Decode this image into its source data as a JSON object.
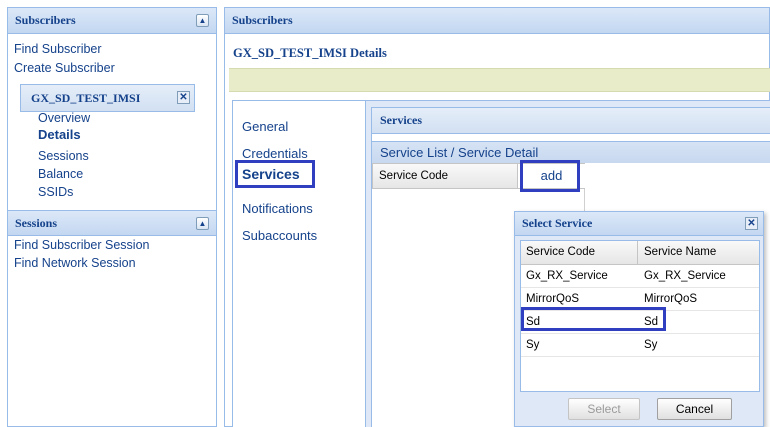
{
  "left_nav": {
    "subscribers_header": "Subscribers",
    "links": [
      "Find Subscriber",
      "Create Subscriber"
    ],
    "subscriber_tab": {
      "label": "GX_SD_TEST_IMSI",
      "items": [
        "Overview",
        "Details",
        "Sessions",
        "Balance",
        "SSIDs"
      ],
      "active": "Details"
    },
    "sessions_header": "Sessions",
    "session_links": [
      "Find Subscriber Session",
      "Find Network Session"
    ]
  },
  "main": {
    "header": "Subscribers",
    "detail_title": "GX_SD_TEST_IMSI Details",
    "tabs": [
      "General",
      "Credentials",
      "Services",
      "Notifications",
      "Subaccounts"
    ],
    "active_tab": "Services",
    "services_header": "Services",
    "service_list_title": "Service List / Service Detail",
    "grid_column": "Service Code",
    "add_label": "add"
  },
  "dialog": {
    "title": "Select Service",
    "columns": [
      "Service Code",
      "Service Name"
    ],
    "rows": [
      {
        "code": "Gx_RX_Service",
        "name": "Gx_RX_Service"
      },
      {
        "code": "MirrorQoS",
        "name": "MirrorQoS"
      },
      {
        "code": "Sd",
        "name": "Sd"
      },
      {
        "code": "Sy",
        "name": "Sy"
      }
    ],
    "selected_row": "Sd",
    "select_label": "Select",
    "cancel_label": "Cancel"
  },
  "colors": {
    "header_text": "#15428b",
    "highlight_box": "#2f3fbf",
    "border": "#99bbe8",
    "notice_bar": "#e9ecc8"
  }
}
